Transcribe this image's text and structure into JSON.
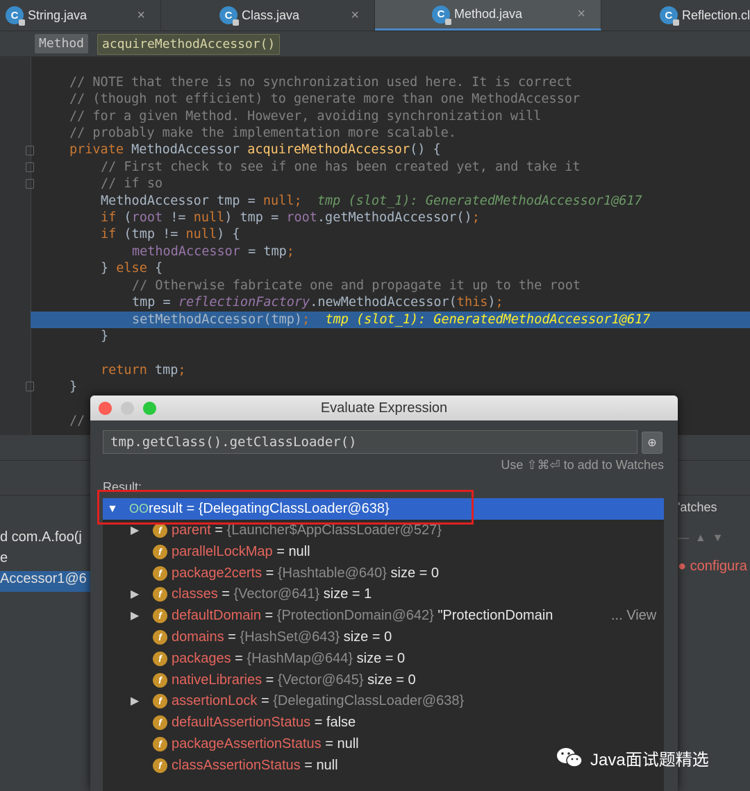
{
  "tabs": [
    {
      "label": "String.java",
      "icon": "class-icon",
      "close": "×"
    },
    {
      "label": "Class.java",
      "icon": "class-icon",
      "close": "×"
    },
    {
      "label": "Method.java",
      "icon": "class-icon",
      "close": "×",
      "active": true
    },
    {
      "label": "Reflection.cl",
      "icon": "class-icon"
    }
  ],
  "breadcrumb": {
    "item1": "Method",
    "item2": "acquireMethodAccessor()"
  },
  "code": {
    "l1": "// NOTE that there is no synchronization used here. It is correct",
    "l2": "// (though not efficient) to generate more than one MethodAccessor",
    "l3": "// for a given Method. However, avoiding synchronization will",
    "l4": "// probably make the implementation more scalable.",
    "l5_kw": "private ",
    "l5_type": "MethodAccessor ",
    "l5_fn": "acquireMethodAccessor",
    "l5_rest": "() {",
    "l6": "// First check to see if one has been created yet, and take it",
    "l7": "// if so",
    "l8_a": "MethodAccessor tmp = ",
    "l8_null": "null",
    "l8_semi": ";",
    "l8_hint": "tmp (slot_1): GeneratedMethodAccessor1@617",
    "l9_if": "if ",
    "l9_a": "(",
    "l9_root": "root",
    "l9_b": " != ",
    "l9_null": "null",
    "l9_c": ") tmp = ",
    "l9_root2": "root",
    "l9_d": ".getMethodAccessor()",
    "l9_semi": ";",
    "l10_if": "if ",
    "l10_a": "(tmp != ",
    "l10_null": "null",
    "l10_b": ") {",
    "l11_field": "methodAccessor",
    "l11_b": " = tmp",
    "l11_semi": ";",
    "l12_a": "} ",
    "l12_else": "else ",
    "l12_b": "{",
    "l13": "// Otherwise fabricate one and propagate it up to the root",
    "l14_a": "tmp = ",
    "l14_rf": "reflectionFactory",
    "l14_b": ".newMethodAccessor(",
    "l14_this": "this",
    "l14_c": ")",
    "l14_semi": ";",
    "l15_a": "setMethodAccessor(tmp)",
    "l15_semi": ";",
    "l15_hint": "tmp (slot_1): GeneratedMethodAccessor1@617",
    "l16": "}",
    "l18_ret": "return ",
    "l18_b": "tmp",
    "l18_semi": ";",
    "l19": "}",
    "l21": "//"
  },
  "background_panel": {
    "watches_label": "'atches",
    "frame1": "d com.A.foo(j",
    "frame2": "e",
    "frame3": "Accessor1@6",
    "error_text": "configura"
  },
  "dialog": {
    "title": "Evaluate Expression",
    "expression": "tmp.getClass().getClassLoader()",
    "hint": "Use ⇧⌘⏎ to add to Watches",
    "result_label": "Result:",
    "result_row": "result = {DelegatingClassLoader@638}",
    "fields": [
      {
        "name": "parent",
        "value": "{Launcher$AppClassLoader@527}",
        "extra": "",
        "expandable": true
      },
      {
        "name": "parallelLockMap",
        "value": "null",
        "extra": "",
        "expandable": false
      },
      {
        "name": "package2certs",
        "value": "{Hashtable@640}",
        "extra": "size = 0",
        "expandable": false
      },
      {
        "name": "classes",
        "value": "{Vector@641}",
        "extra": "size = 1",
        "expandable": true
      },
      {
        "name": "defaultDomain",
        "value": "{ProtectionDomain@642}",
        "extra": "\"ProtectionDomain",
        "expandable": true,
        "view": "... View"
      },
      {
        "name": "domains",
        "value": "{HashSet@643}",
        "extra": "size = 0",
        "expandable": false
      },
      {
        "name": "packages",
        "value": "{HashMap@644}",
        "extra": "size = 0",
        "expandable": false
      },
      {
        "name": "nativeLibraries",
        "value": "{Vector@645}",
        "extra": "size = 0",
        "expandable": false
      },
      {
        "name": "assertionLock",
        "value": "{DelegatingClassLoader@638}",
        "extra": "",
        "expandable": true
      },
      {
        "name": "defaultAssertionStatus",
        "value": "false",
        "extra": "",
        "expandable": false
      },
      {
        "name": "packageAssertionStatus",
        "value": "null",
        "extra": "",
        "expandable": false
      },
      {
        "name": "classAssertionStatus",
        "value": "null",
        "extra": "",
        "expandable": false
      }
    ]
  },
  "watermark": "Java面试题精选",
  "colors": {
    "selection": "#2f65ca",
    "highlight_line": "#2d6099",
    "keyword": "#cc7832",
    "method": "#ffc66d",
    "field": "#9876aa",
    "annotation_red": "#e02020"
  }
}
